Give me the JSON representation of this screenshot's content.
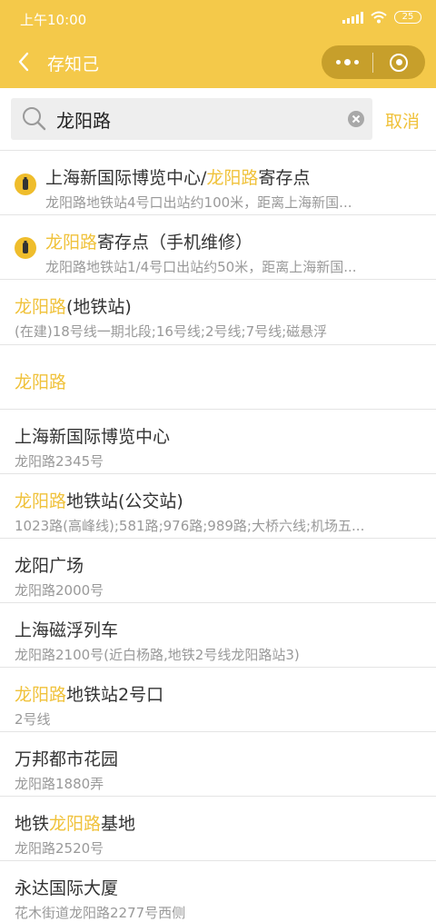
{
  "status_bar": {
    "time": "上午10:00",
    "battery": "25"
  },
  "nav": {
    "title": "存知己"
  },
  "search": {
    "query": "龙阳路",
    "cancel_label": "取消"
  },
  "results": [
    {
      "type": "storage",
      "title_before": "上海新国际博览中心/",
      "title_highlight": "龙阳路",
      "title_after": "寄存点",
      "subtitle": "龙阳路地铁站4号口出站约100米，距离上海新国..."
    },
    {
      "type": "storage",
      "title_before": "",
      "title_highlight": "龙阳路",
      "title_after": "寄存点（手机维修）",
      "subtitle": "龙阳路地铁站1/4号口出站约50米，距离上海新国..."
    },
    {
      "type": "place",
      "title_before": "",
      "title_highlight": "龙阳路",
      "title_after": "(地铁站)",
      "subtitle": "(在建)18号线一期北段;16号线;2号线;7号线;磁悬浮"
    },
    {
      "type": "single",
      "title_before": "",
      "title_highlight": "龙阳路",
      "title_after": "",
      "subtitle": ""
    },
    {
      "type": "place",
      "title_before": "上海新国际博览中心",
      "title_highlight": "",
      "title_after": "",
      "subtitle": "龙阳路2345号"
    },
    {
      "type": "place",
      "title_before": "",
      "title_highlight": "龙阳路",
      "title_after": "地铁站(公交站)",
      "subtitle": "1023路(高峰线);581路;976路;989路;大桥六线;机场五..."
    },
    {
      "type": "place",
      "title_before": "龙阳广场",
      "title_highlight": "",
      "title_after": "",
      "subtitle": "龙阳路2000号"
    },
    {
      "type": "place",
      "title_before": "上海磁浮列车",
      "title_highlight": "",
      "title_after": "",
      "subtitle": "龙阳路2100号(近白杨路,地铁2号线龙阳路站3)"
    },
    {
      "type": "place",
      "title_before": "",
      "title_highlight": "龙阳路",
      "title_after": "地铁站2号口",
      "subtitle": "2号线"
    },
    {
      "type": "place",
      "title_before": "万邦都市花园",
      "title_highlight": "",
      "title_after": "",
      "subtitle": "龙阳路1880弄"
    },
    {
      "type": "place",
      "title_before": "地铁",
      "title_highlight": "龙阳路",
      "title_after": "基地",
      "subtitle": "龙阳路2520号"
    },
    {
      "type": "place",
      "title_before": "永达国际大厦",
      "title_highlight": "",
      "title_after": "",
      "subtitle": "花木街道龙阳路2277号西侧"
    }
  ],
  "colors": {
    "brand": "#f4c94a",
    "highlight": "#f0c23b",
    "capsule": "#c79f2b"
  }
}
